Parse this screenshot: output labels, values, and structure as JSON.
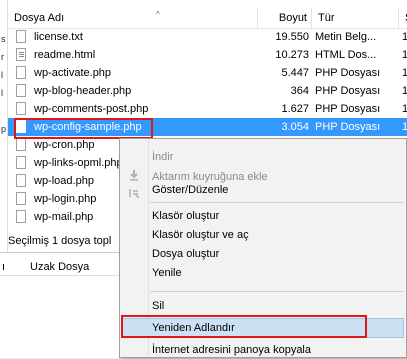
{
  "columns": {
    "name": "Dosya Adı",
    "size": "Boyut",
    "type": "Tür",
    "extra": "S"
  },
  "files": [
    {
      "name": "license.txt",
      "size": "19.550",
      "type": "Metin Belg...",
      "extra": "1"
    },
    {
      "name": "readme.html",
      "size": "10.273",
      "type": "HTML Dos...",
      "extra": "1"
    },
    {
      "name": "wp-activate.php",
      "size": "5.447",
      "type": "PHP Dosyası",
      "extra": "1"
    },
    {
      "name": "wp-blog-header.php",
      "size": "364",
      "type": "PHP Dosyası",
      "extra": "1"
    },
    {
      "name": "wp-comments-post.php",
      "size": "1.627",
      "type": "PHP Dosyası",
      "extra": "1"
    },
    {
      "name": "wp-config-sample.php",
      "size": "3.054",
      "type": "PHP Dosyası",
      "extra": "1"
    },
    {
      "name": "wp-cron.php",
      "size": "",
      "type": "syası",
      "extra": "1"
    },
    {
      "name": "wp-links-opml.php",
      "size": "",
      "type": "syası",
      "extra": "1"
    },
    {
      "name": "wp-load.php",
      "size": "",
      "type": "syası",
      "extra": "1"
    },
    {
      "name": "wp-login.php",
      "size": "",
      "type": "syası",
      "extra": "1"
    },
    {
      "name": "wp-mail.php",
      "size": "",
      "type": "syası",
      "extra": "1"
    }
  ],
  "status": "Seçilmiş 1 dosya topl",
  "left_strip": [
    "s",
    "r",
    "l",
    "l",
    "p"
  ],
  "bottom_tabs": {
    "left": "ı",
    "remote": "Uzak Dosya"
  },
  "context_menu": {
    "download": "İndir",
    "add_to_queue": "Aktarım kuyruğuna ekle",
    "view_edit": "Göster/Düzenle",
    "create_dir": "Klasör oluştur",
    "create_dir_enter": "Klasör oluştur ve aç",
    "create_file": "Dosya oluştur",
    "refresh": "Yenile",
    "delete": "Sil",
    "rename": "Yeniden Adlandır",
    "copy_url": "İnternet adresini panoya kopyala"
  },
  "colors": {
    "selection": "#3399ff",
    "highlight": "#cce1f4",
    "annotation": "#e0171a"
  }
}
